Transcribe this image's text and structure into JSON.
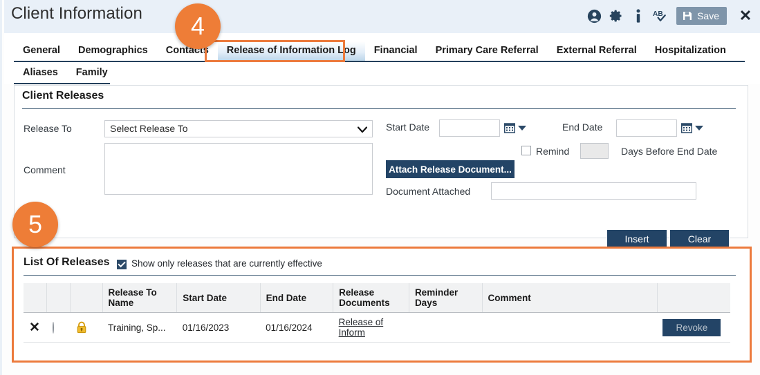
{
  "header": {
    "title": "Client Information",
    "icons": [
      {
        "name": "account-icon",
        "glyph": "person-circle"
      },
      {
        "name": "settings-gear-icon",
        "glyph": "gear"
      },
      {
        "name": "info-icon",
        "glyph": "i"
      },
      {
        "name": "spell-check-icon",
        "glyph": "AB"
      }
    ],
    "save_label": "Save",
    "close_label": "✕"
  },
  "tabs": {
    "row1": [
      {
        "label": "General",
        "selected": false
      },
      {
        "label": "Demographics",
        "selected": false
      },
      {
        "label": "Contacts",
        "selected": false
      },
      {
        "label": "Release of Information Log",
        "selected": true
      },
      {
        "label": "Financial",
        "selected": false
      },
      {
        "label": "Primary Care Referral",
        "selected": false
      },
      {
        "label": "External Referral",
        "selected": false
      },
      {
        "label": "Hospitalization",
        "selected": false
      }
    ],
    "row2": [
      {
        "label": "Aliases",
        "selected": false
      },
      {
        "label": "Family",
        "selected": false
      }
    ]
  },
  "badges": [
    {
      "name": "step-badge-4",
      "number": "4"
    },
    {
      "name": "step-badge-5",
      "number": "5"
    }
  ],
  "client_releases": {
    "title": "Client Releases",
    "release_to_label": "Release To",
    "release_to_value": "Select Release To",
    "comment_label": "Comment",
    "comment_value": "",
    "start_date_label": "Start Date",
    "start_date_value": "",
    "end_date_label": "End Date",
    "end_date_value": "",
    "remind_label": "Remind",
    "remind_checked": false,
    "remind_days_value": "",
    "days_before_label": "Days Before End Date",
    "attach_button_label": "Attach Release Document...",
    "document_attached_label": "Document Attached",
    "document_attached_value": "",
    "insert_label": "Insert",
    "clear_label": "Clear"
  },
  "list_of_releases": {
    "title": "List Of Releases",
    "filter_label": "Show only releases that are currently effective",
    "filter_checked": true,
    "columns": [
      {
        "label": "",
        "name": "col-delete"
      },
      {
        "label": "",
        "name": "col-select"
      },
      {
        "label": "",
        "name": "col-lock"
      },
      {
        "label": "Release To Name",
        "name": "col-release-to-name"
      },
      {
        "label": "Start Date",
        "name": "col-start-date"
      },
      {
        "label": "End Date",
        "name": "col-end-date"
      },
      {
        "label": "Release Documents",
        "name": "col-release-documents"
      },
      {
        "label": "Reminder Days",
        "name": "col-reminder-days"
      },
      {
        "label": "Comment",
        "name": "col-comment"
      },
      {
        "label": "",
        "name": "col-action"
      }
    ],
    "rows": [
      {
        "delete_glyph": "✕",
        "selected": false,
        "locked": true,
        "release_to_name": "Training, Sp...",
        "start_date": "01/16/2023",
        "end_date": "01/16/2024",
        "release_documents": "Release of Inform",
        "reminder_days": "",
        "comment": "",
        "action_label": "Revoke"
      }
    ]
  },
  "colors": {
    "header_bg": "#e9f0f8",
    "accent_dark": "#234466",
    "highlight_orange": "#ec7a3c",
    "badge_orange": "#ee7d37",
    "save_bg": "#7f95aa",
    "lock_gold": "#e8b01e"
  }
}
